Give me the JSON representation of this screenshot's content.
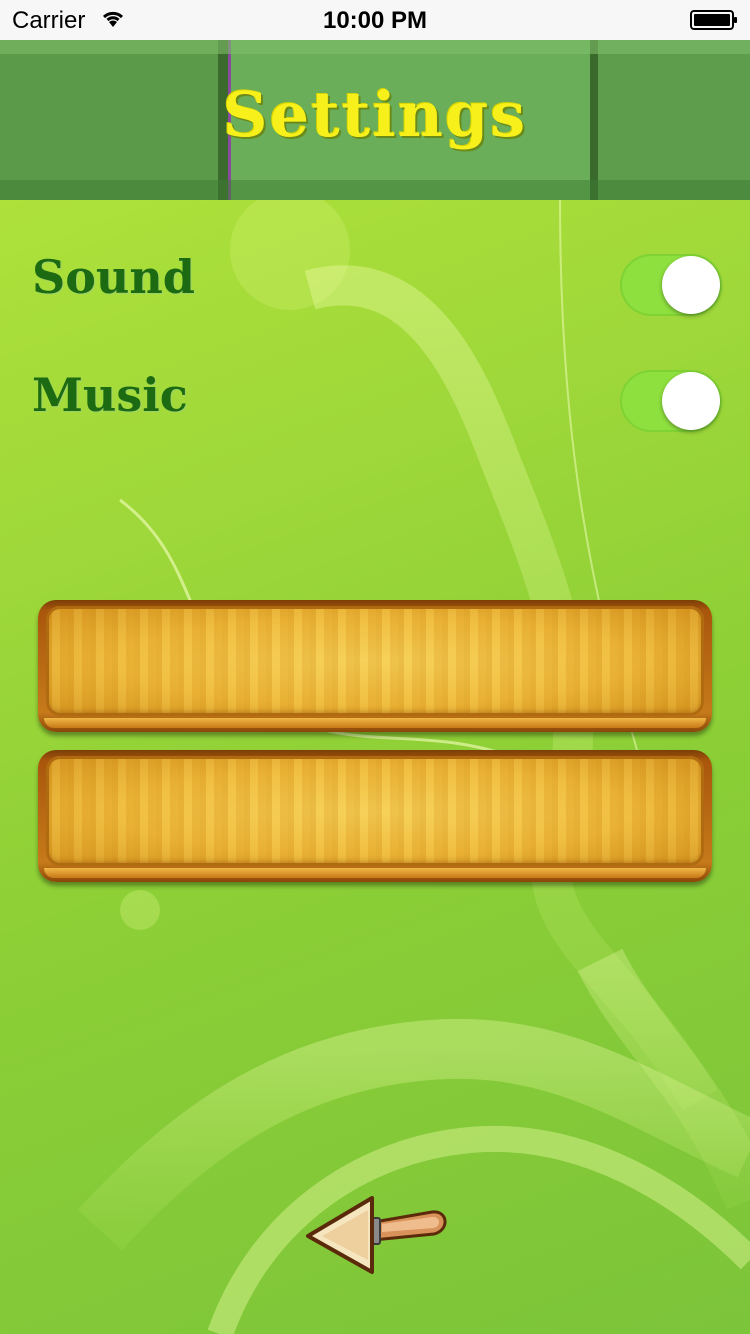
{
  "status_bar": {
    "carrier": "Carrier",
    "time": "10:00 PM",
    "wifi_icon": "wifi-icon",
    "battery_icon": "battery-icon"
  },
  "header": {
    "title": "Settings"
  },
  "settings": [
    {
      "label": "Sound",
      "enabled": true
    },
    {
      "label": "Music",
      "enabled": true
    }
  ],
  "panels": [
    {
      "label": ""
    },
    {
      "label": ""
    }
  ],
  "back_button": {
    "icon": "arrow-left-icon"
  },
  "colors": {
    "title": "#f7f01a",
    "label": "#1c6a12",
    "toggle_on": "#8ee03e",
    "background": "#9fd83a",
    "wood": "#eeb93a"
  }
}
